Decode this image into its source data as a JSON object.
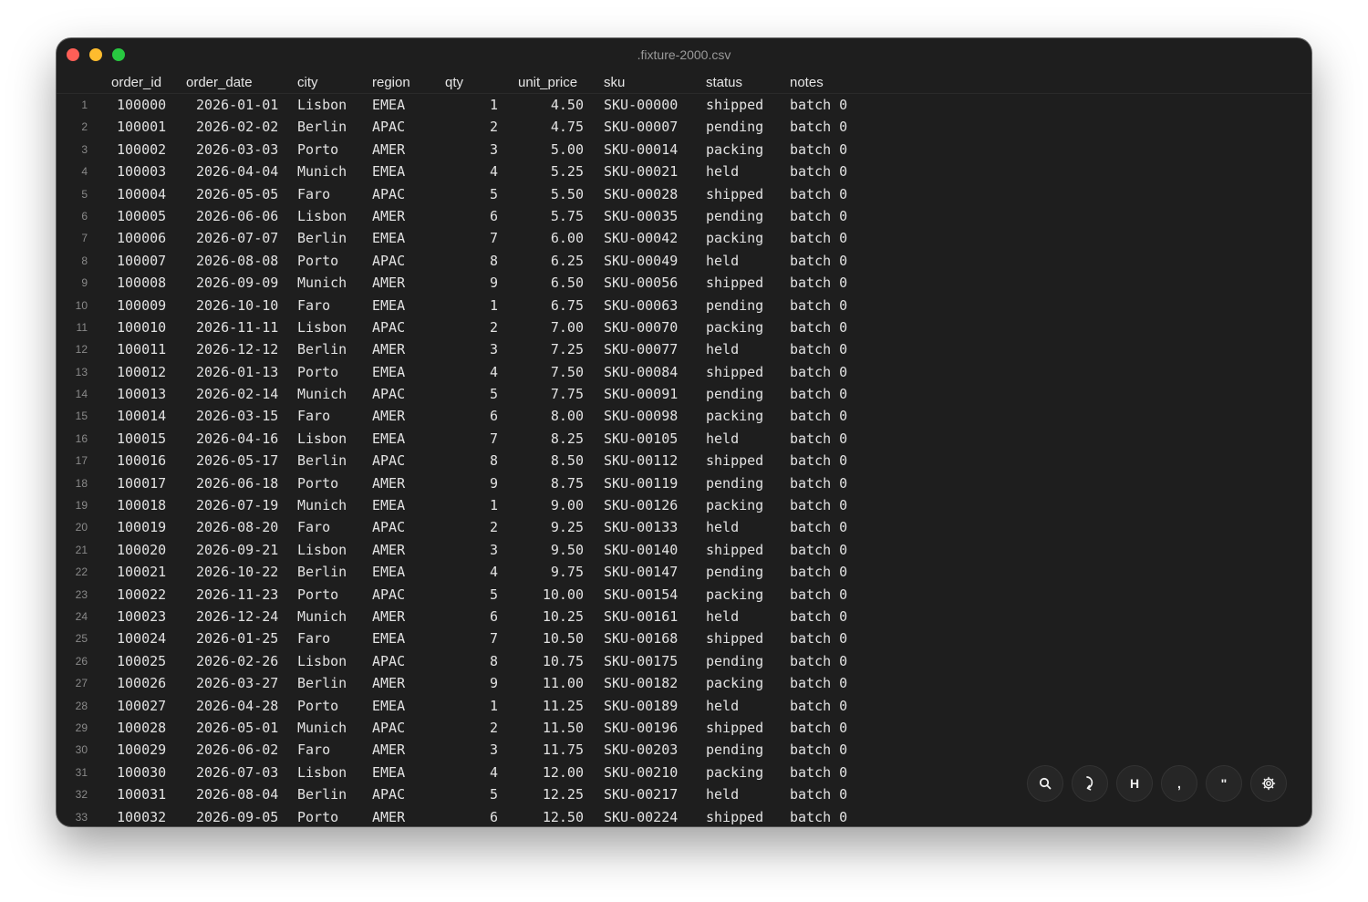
{
  "window": {
    "title": ".fixture-2000.csv"
  },
  "columns": [
    "order_id",
    "order_date",
    "city",
    "region",
    "qty",
    "unit_price",
    "sku",
    "status",
    "notes"
  ],
  "rows": [
    [
      "1",
      "100000",
      "2026-01-01",
      "Lisbon",
      "EMEA",
      "1",
      "4.50",
      "SKU-00000",
      "shipped",
      "batch 0"
    ],
    [
      "2",
      "100001",
      "2026-02-02",
      "Berlin",
      "APAC",
      "2",
      "4.75",
      "SKU-00007",
      "pending",
      "batch 0"
    ],
    [
      "3",
      "100002",
      "2026-03-03",
      "Porto",
      "AMER",
      "3",
      "5.00",
      "SKU-00014",
      "packing",
      "batch 0"
    ],
    [
      "4",
      "100003",
      "2026-04-04",
      "Munich",
      "EMEA",
      "4",
      "5.25",
      "SKU-00021",
      "held",
      "batch 0"
    ],
    [
      "5",
      "100004",
      "2026-05-05",
      "Faro",
      "APAC",
      "5",
      "5.50",
      "SKU-00028",
      "shipped",
      "batch 0"
    ],
    [
      "6",
      "100005",
      "2026-06-06",
      "Lisbon",
      "AMER",
      "6",
      "5.75",
      "SKU-00035",
      "pending",
      "batch 0"
    ],
    [
      "7",
      "100006",
      "2026-07-07",
      "Berlin",
      "EMEA",
      "7",
      "6.00",
      "SKU-00042",
      "packing",
      "batch 0"
    ],
    [
      "8",
      "100007",
      "2026-08-08",
      "Porto",
      "APAC",
      "8",
      "6.25",
      "SKU-00049",
      "held",
      "batch 0"
    ],
    [
      "9",
      "100008",
      "2026-09-09",
      "Munich",
      "AMER",
      "9",
      "6.50",
      "SKU-00056",
      "shipped",
      "batch 0"
    ],
    [
      "10",
      "100009",
      "2026-10-10",
      "Faro",
      "EMEA",
      "1",
      "6.75",
      "SKU-00063",
      "pending",
      "batch 0"
    ],
    [
      "11",
      "100010",
      "2026-11-11",
      "Lisbon",
      "APAC",
      "2",
      "7.00",
      "SKU-00070",
      "packing",
      "batch 0"
    ],
    [
      "12",
      "100011",
      "2026-12-12",
      "Berlin",
      "AMER",
      "3",
      "7.25",
      "SKU-00077",
      "held",
      "batch 0"
    ],
    [
      "13",
      "100012",
      "2026-01-13",
      "Porto",
      "EMEA",
      "4",
      "7.50",
      "SKU-00084",
      "shipped",
      "batch 0"
    ],
    [
      "14",
      "100013",
      "2026-02-14",
      "Munich",
      "APAC",
      "5",
      "7.75",
      "SKU-00091",
      "pending",
      "batch 0"
    ],
    [
      "15",
      "100014",
      "2026-03-15",
      "Faro",
      "AMER",
      "6",
      "8.00",
      "SKU-00098",
      "packing",
      "batch 0"
    ],
    [
      "16",
      "100015",
      "2026-04-16",
      "Lisbon",
      "EMEA",
      "7",
      "8.25",
      "SKU-00105",
      "held",
      "batch 0"
    ],
    [
      "17",
      "100016",
      "2026-05-17",
      "Berlin",
      "APAC",
      "8",
      "8.50",
      "SKU-00112",
      "shipped",
      "batch 0"
    ],
    [
      "18",
      "100017",
      "2026-06-18",
      "Porto",
      "AMER",
      "9",
      "8.75",
      "SKU-00119",
      "pending",
      "batch 0"
    ],
    [
      "19",
      "100018",
      "2026-07-19",
      "Munich",
      "EMEA",
      "1",
      "9.00",
      "SKU-00126",
      "packing",
      "batch 0"
    ],
    [
      "20",
      "100019",
      "2026-08-20",
      "Faro",
      "APAC",
      "2",
      "9.25",
      "SKU-00133",
      "held",
      "batch 0"
    ],
    [
      "21",
      "100020",
      "2026-09-21",
      "Lisbon",
      "AMER",
      "3",
      "9.50",
      "SKU-00140",
      "shipped",
      "batch 0"
    ],
    [
      "22",
      "100021",
      "2026-10-22",
      "Berlin",
      "EMEA",
      "4",
      "9.75",
      "SKU-00147",
      "pending",
      "batch 0"
    ],
    [
      "23",
      "100022",
      "2026-11-23",
      "Porto",
      "APAC",
      "5",
      "10.00",
      "SKU-00154",
      "packing",
      "batch 0"
    ],
    [
      "24",
      "100023",
      "2026-12-24",
      "Munich",
      "AMER",
      "6",
      "10.25",
      "SKU-00161",
      "held",
      "batch 0"
    ],
    [
      "25",
      "100024",
      "2026-01-25",
      "Faro",
      "EMEA",
      "7",
      "10.50",
      "SKU-00168",
      "shipped",
      "batch 0"
    ],
    [
      "26",
      "100025",
      "2026-02-26",
      "Lisbon",
      "APAC",
      "8",
      "10.75",
      "SKU-00175",
      "pending",
      "batch 0"
    ],
    [
      "27",
      "100026",
      "2026-03-27",
      "Berlin",
      "AMER",
      "9",
      "11.00",
      "SKU-00182",
      "packing",
      "batch 0"
    ],
    [
      "28",
      "100027",
      "2026-04-28",
      "Porto",
      "EMEA",
      "1",
      "11.25",
      "SKU-00189",
      "held",
      "batch 0"
    ],
    [
      "29",
      "100028",
      "2026-05-01",
      "Munich",
      "APAC",
      "2",
      "11.50",
      "SKU-00196",
      "shipped",
      "batch 0"
    ],
    [
      "30",
      "100029",
      "2026-06-02",
      "Faro",
      "AMER",
      "3",
      "11.75",
      "SKU-00203",
      "pending",
      "batch 0"
    ],
    [
      "31",
      "100030",
      "2026-07-03",
      "Lisbon",
      "EMEA",
      "4",
      "12.00",
      "SKU-00210",
      "packing",
      "batch 0"
    ],
    [
      "32",
      "100031",
      "2026-08-04",
      "Berlin",
      "APAC",
      "5",
      "12.25",
      "SKU-00217",
      "held",
      "batch 0"
    ],
    [
      "33",
      "100032",
      "2026-09-05",
      "Porto",
      "AMER",
      "6",
      "12.50",
      "SKU-00224",
      "shipped",
      "batch 0"
    ]
  ],
  "toolbar": {
    "buttons": [
      {
        "name": "search-button",
        "icon": "search-icon"
      },
      {
        "name": "jump-button",
        "icon": "arrow-curve-icon"
      },
      {
        "name": "header-toggle-button",
        "icon": "header-icon",
        "label": "H"
      },
      {
        "name": "delimiter-button",
        "icon": "comma-icon",
        "label": ","
      },
      {
        "name": "quote-button",
        "icon": "quote-icon",
        "label": "\""
      },
      {
        "name": "settings-button",
        "icon": "gear-icon"
      }
    ]
  },
  "colors": {
    "window_bg": "#1e1e1e",
    "text": "#e2e2e2",
    "row_number": "#8a8a8a",
    "close": "#ff5f57",
    "minimize": "#febc2e",
    "maximize": "#28c840"
  }
}
